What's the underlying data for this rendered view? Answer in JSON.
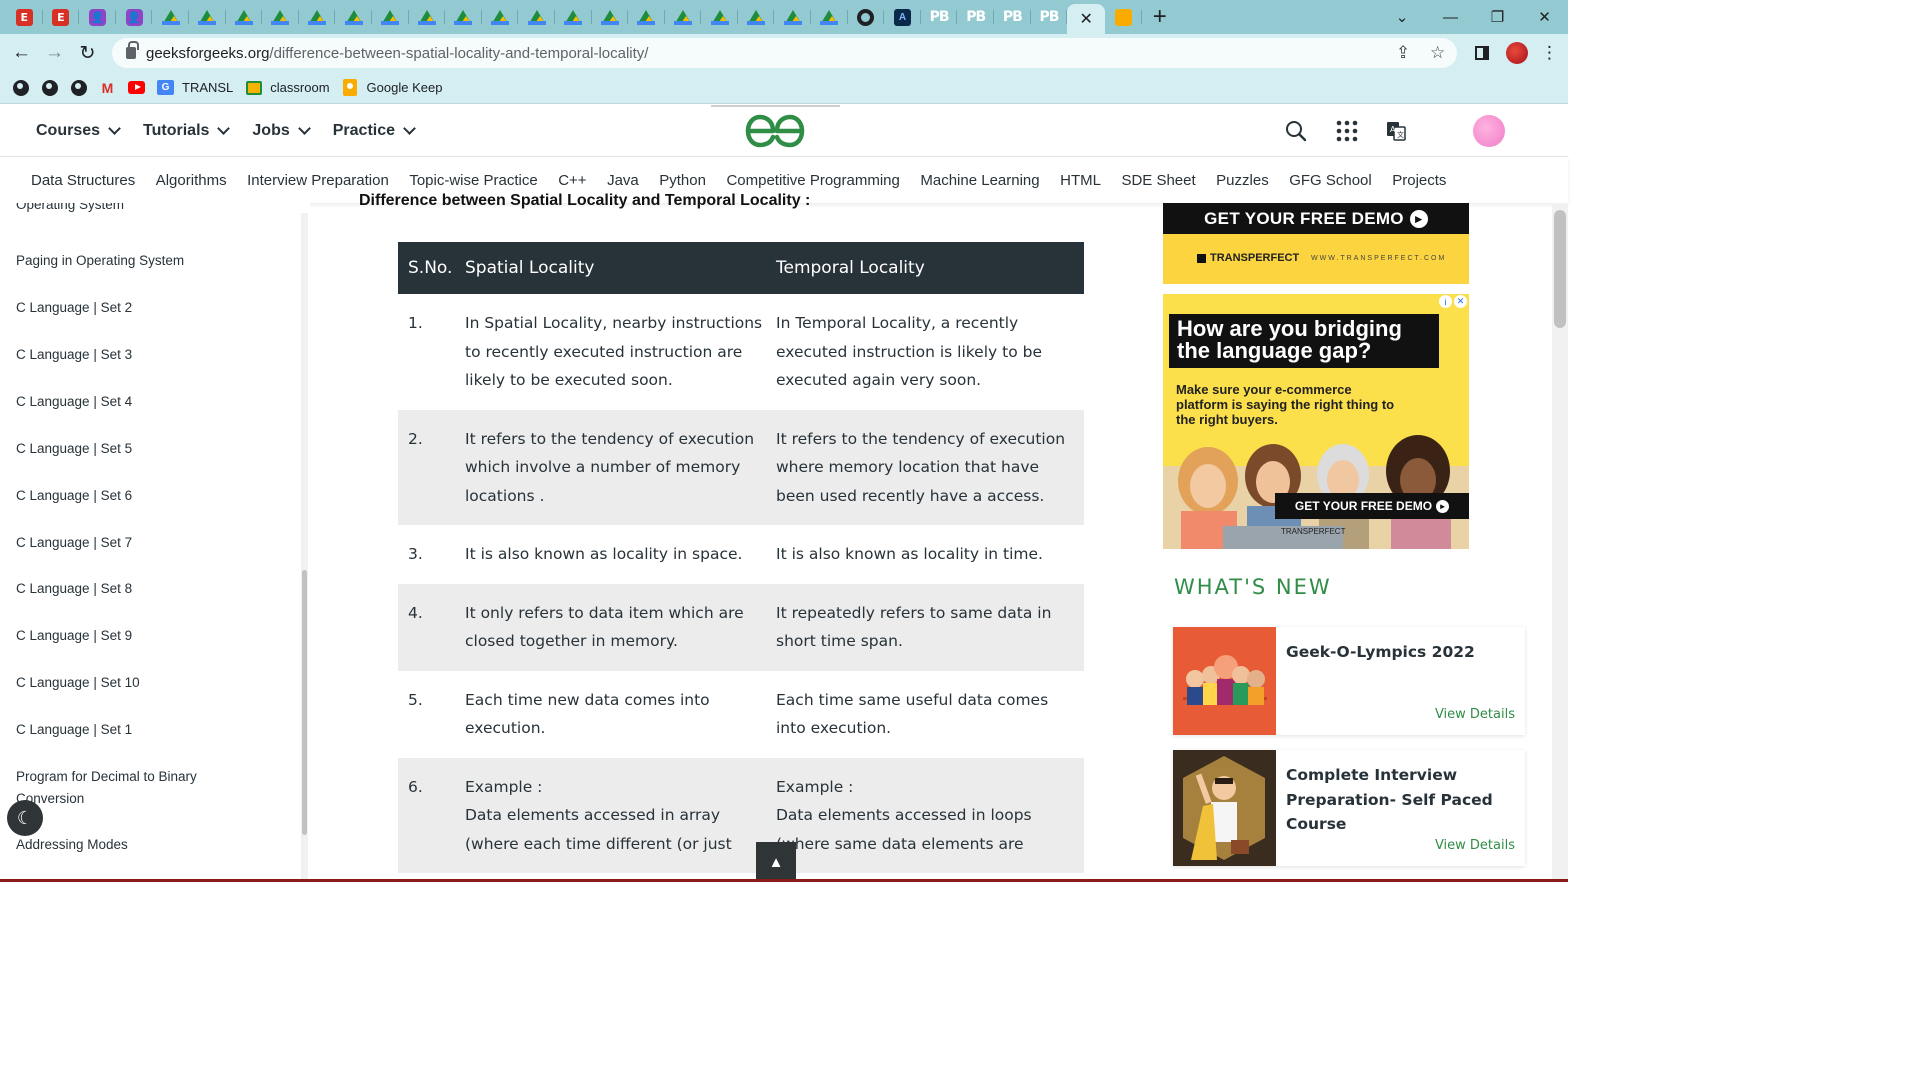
{
  "browser": {
    "tabs": [
      {
        "icon": "e-icon",
        "letter": "E"
      },
      {
        "icon": "e-icon",
        "letter": "E"
      },
      {
        "icon": "meet-icon",
        "letter": "👤"
      },
      {
        "icon": "meet-icon",
        "letter": "👤"
      },
      {
        "icon": "drive-icon"
      },
      {
        "icon": "drive-icon"
      },
      {
        "icon": "drive-icon"
      },
      {
        "icon": "drive-icon"
      },
      {
        "icon": "drive-icon"
      },
      {
        "icon": "drive-icon"
      },
      {
        "icon": "drive-icon"
      },
      {
        "icon": "drive-icon"
      },
      {
        "icon": "drive-icon"
      },
      {
        "icon": "drive-icon"
      },
      {
        "icon": "drive-icon"
      },
      {
        "icon": "drive-icon"
      },
      {
        "icon": "drive-icon"
      },
      {
        "icon": "drive-icon"
      },
      {
        "icon": "drive-icon"
      },
      {
        "icon": "drive-icon"
      },
      {
        "icon": "drive-icon"
      },
      {
        "icon": "drive-icon"
      },
      {
        "icon": "drive-icon"
      },
      {
        "icon": "globe-icon"
      },
      {
        "icon": "dark-site-icon",
        "letter": "A"
      },
      {
        "icon": "pb-icon",
        "letter": "PB"
      },
      {
        "icon": "pb-icon",
        "letter": "PB"
      },
      {
        "icon": "pb-icon",
        "letter": "PB"
      },
      {
        "icon": "pb-icon",
        "letter": "PB"
      }
    ],
    "url_domain": "geeksforgeeks.org",
    "url_path": "/difference-between-spatial-locality-and-temporal-locality/",
    "bookmarks": [
      {
        "icon": "globe-icon",
        "label": ""
      },
      {
        "icon": "globe-icon",
        "label": ""
      },
      {
        "icon": "globe-icon",
        "label": ""
      },
      {
        "icon": "gmail-icon",
        "label": ""
      },
      {
        "icon": "youtube-icon",
        "label": ""
      },
      {
        "icon": "translate-icon",
        "label": "TRANSL"
      },
      {
        "icon": "classroom-icon",
        "label": "classroom"
      },
      {
        "icon": "keep-icon",
        "label": "Google Keep"
      }
    ]
  },
  "site": {
    "main_nav": [
      "Courses",
      "Tutorials",
      "Jobs",
      "Practice"
    ],
    "sub_nav": [
      "Data Structures",
      "Algorithms",
      "Interview Preparation",
      "Topic-wise Practice",
      "C++",
      "Java",
      "Python",
      "Competitive Programming",
      "Machine Learning",
      "HTML",
      "SDE Sheet",
      "Puzzles",
      "GFG School",
      "Projects"
    ]
  },
  "sidebar": {
    "items": [
      "Operating System",
      "Paging in Operating System",
      "C Language | Set 2",
      "C Language | Set 3",
      "C Language | Set 4",
      "C Language | Set 5",
      "C Language | Set 6",
      "C Language | Set 7",
      "C Language | Set 8",
      "C Language | Set 9",
      "C Language | Set 10",
      "C Language | Set 1",
      "Program for Decimal to Binary Conversion",
      "Addressing Modes"
    ]
  },
  "article": {
    "heading": "Difference between Spatial Locality and Temporal Locality :",
    "table": {
      "headers": [
        "S.No.",
        "Spatial Locality",
        "Temporal Locality"
      ],
      "rows": [
        {
          "sno": "1.",
          "spatial": "In Spatial Locality, nearby instructions to recently executed instruction are likely to be executed soon.",
          "temporal": "In Temporal Locality, a recently executed instruction is likely to be executed again very soon."
        },
        {
          "sno": "2.",
          "spatial": "It refers to the tendency of execution which involve a number of memory locations .",
          "temporal": "It refers to the tendency of execution where memory location that have been used recently have a access."
        },
        {
          "sno": "3.",
          "spatial": "It is also known as locality in space.",
          "temporal": "It is also known as locality in time."
        },
        {
          "sno": "4.",
          "spatial": "It only refers to data item which are closed together in memory.",
          "temporal": "It repeatedly refers to same data in short time span."
        },
        {
          "sno": "5.",
          "spatial": "Each time new data comes into execution.",
          "temporal": "Each time same useful data comes into execution."
        },
        {
          "sno": "6.",
          "spatial": "Example :\nData elements accessed in array (where each time different (or just",
          "temporal": "Example :\nData elements accessed in loops (where same data elements are"
        }
      ]
    }
  },
  "ads": {
    "top_cta": "GET YOUR FREE DEMO",
    "brand": "TRANSPERFECT",
    "brand_site": "WWW.TRANSPERFECT.COM",
    "headline": "How are you bridging the language gap?",
    "subtext": "Make sure your e-commerce platform is saying the right thing to the right buyers.",
    "cta": "GET YOUR FREE DEMO",
    "badge_info": "i",
    "badge_close": "✕"
  },
  "whats_new": {
    "title": "WHAT'S NEW",
    "cards": [
      {
        "title": "Geek-O-Lympics 2022",
        "link": "View Details"
      },
      {
        "title": "Complete Interview Preparation- Self Paced Course",
        "link": "View Details"
      }
    ]
  },
  "colors": {
    "brand_green": "#2f8d46",
    "table_header": "#273239",
    "chrome_tabs": "#93cad2",
    "chrome_toolbar": "#d4eef2"
  }
}
